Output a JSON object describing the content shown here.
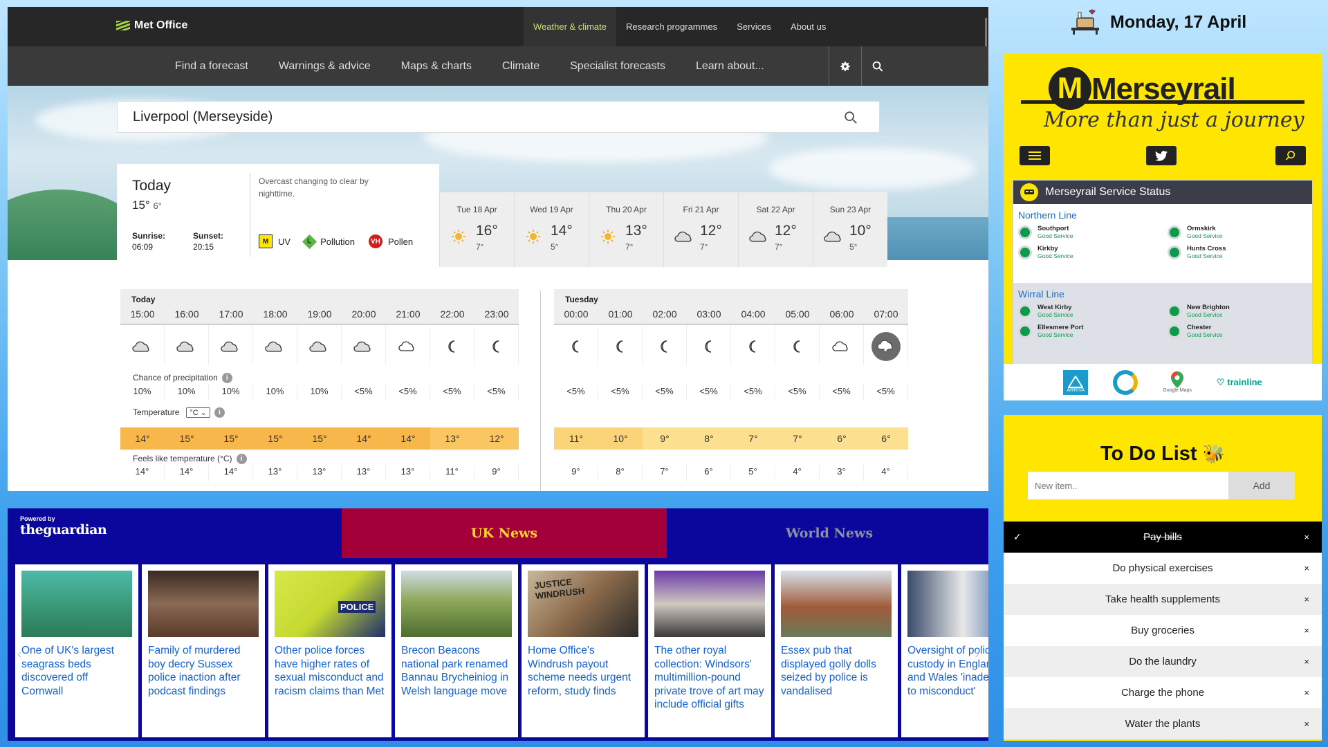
{
  "met": {
    "logo": "Met Office",
    "topnav": [
      "Weather & climate",
      "Research programmes",
      "Services",
      "About us"
    ],
    "nav": [
      "Find a forecast",
      "Warnings & advice",
      "Maps & charts",
      "Climate",
      "Specialist forecasts",
      "Learn about..."
    ],
    "search_value": "Liverpool (Merseyside)",
    "today": {
      "label": "Today",
      "high": "15°",
      "low": "6°",
      "sunrise_label": "Sunrise:",
      "sunrise": "06:09",
      "sunset_label": "Sunset:",
      "sunset": "20:15",
      "description": "Overcast changing to clear by nighttime.",
      "uv_badge": "M",
      "uv_label": "UV",
      "pollution_badge": "L",
      "pollution_label": "Pollution",
      "pollen_badge": "VH",
      "pollen_label": "Pollen"
    },
    "days": [
      {
        "label": "Tue 18 Apr",
        "high": "16°",
        "low": "7°",
        "icon": "sun-icon"
      },
      {
        "label": "Wed 19 Apr",
        "high": "14°",
        "low": "5°",
        "icon": "sun-icon"
      },
      {
        "label": "Thu 20 Apr",
        "high": "13°",
        "low": "7°",
        "icon": "sun-icon"
      },
      {
        "label": "Fri 21 Apr",
        "high": "12°",
        "low": "7°",
        "icon": "cloud-icon"
      },
      {
        "label": "Sat 22 Apr",
        "high": "12°",
        "low": "7°",
        "icon": "cloud-icon"
      },
      {
        "label": "Sun 23 Apr",
        "high": "10°",
        "low": "5°",
        "icon": "cloud-icon"
      }
    ],
    "hourly_today": {
      "label": "Today",
      "times": [
        "15:00",
        "16:00",
        "17:00",
        "18:00",
        "19:00",
        "20:00",
        "21:00",
        "22:00",
        "23:00"
      ],
      "icons": [
        "cloud",
        "cloud",
        "cloud",
        "cloud",
        "cloud",
        "cloud",
        "partly-cloudy-night",
        "moon",
        "moon"
      ],
      "precip": [
        "10%",
        "10%",
        "10%",
        "10%",
        "10%",
        "<5%",
        "<5%",
        "<5%",
        "<5%"
      ],
      "temps": [
        "14°",
        "15°",
        "15°",
        "15°",
        "15°",
        "14°",
        "14°",
        "13°",
        "12°"
      ],
      "feels": [
        "14°",
        "14°",
        "14°",
        "13°",
        "13°",
        "13°",
        "13°",
        "11°",
        "9°"
      ]
    },
    "hourly_tue": {
      "label": "Tuesday",
      "times": [
        "00:00",
        "01:00",
        "02:00",
        "03:00",
        "04:00",
        "05:00",
        "06:00",
        "07:00"
      ],
      "icons": [
        "moon",
        "moon",
        "moon",
        "moon",
        "moon",
        "moon",
        "partly-cloudy-night",
        "next"
      ],
      "precip": [
        "<5%",
        "<5%",
        "<5%",
        "<5%",
        "<5%",
        "<5%",
        "<5%",
        "<5%"
      ],
      "temps": [
        "11°",
        "10°",
        "9°",
        "8°",
        "7°",
        "7°",
        "6°",
        "6°"
      ],
      "feels": [
        "9°",
        "8°",
        "7°",
        "6°",
        "5°",
        "4°",
        "3°",
        "4°"
      ]
    },
    "precip_label": "Chance of precipitation",
    "temp_label": "Temperature",
    "unit": "°C",
    "feels_label": "Feels like temperature (°C)"
  },
  "guardian": {
    "powered_by": "Powered by",
    "brand": "theguardian",
    "tabs": [
      "UK News",
      "World News"
    ],
    "articles": [
      "One of UK's largest seagrass beds discovered off Cornwall",
      "Family of murdered boy decry Sussex police inaction after podcast findings",
      "Other police forces have higher rates of sexual misconduct and racism claims than Met",
      "Brecon Beacons national park renamed Bannau Brycheiniog in Welsh language move",
      "Home Office's Windrush payout scheme needs urgent reform, study finds",
      "The other royal collection: Windsors' multimillion-pound private trove of art may include official gifts",
      "Essex pub that displayed golly dolls seized by police is vandalised",
      "Oversight of police custody in England and Wales 'inadequate to misconduct'"
    ],
    "img_texts": [
      "POLICE",
      "JUSTICE WINDRUSH"
    ]
  },
  "date": "Monday, 17 April",
  "merseyrail": {
    "logo": "Merseyrail",
    "tagline": "More than just a journey",
    "status_title": "Merseyrail Service Status",
    "lines": [
      {
        "name": "Northern Line",
        "stations": [
          {
            "name": "Southport",
            "status": "Good Service"
          },
          {
            "name": "Ormskirk",
            "status": "Good Service"
          },
          {
            "name": "Kirkby",
            "status": "Good Service"
          },
          {
            "name": "Hunts Cross",
            "status": "Good Service"
          }
        ]
      },
      {
        "name": "Wirral Line",
        "stations": [
          {
            "name": "West Kirby",
            "status": "Good Service"
          },
          {
            "name": "New Brighton",
            "status": "Good Service"
          },
          {
            "name": "Ellesmere Port",
            "status": "Good Service"
          },
          {
            "name": "Chester",
            "status": "Good Service"
          }
        ]
      }
    ],
    "partners": [
      "ARRIVA",
      "Google Maps",
      "trainline"
    ]
  },
  "todo": {
    "title": "To Do List",
    "placeholder": "New item..",
    "add_label": "Add",
    "items": [
      {
        "text": "Pay bills",
        "done": true
      },
      {
        "text": "Do physical exercises",
        "done": false
      },
      {
        "text": "Take health supplements",
        "done": false
      },
      {
        "text": "Buy groceries",
        "done": false
      },
      {
        "text": "Do the laundry",
        "done": false
      },
      {
        "text": "Charge the phone",
        "done": false
      },
      {
        "text": "Water the plants",
        "done": false
      }
    ]
  },
  "colors": {
    "met_dark": "#272727",
    "met_orange": "#f7b74a",
    "guardian_blue": "#0b079c",
    "guardian_red": "#a3003a",
    "merseyrail_yellow": "#ffe600",
    "good_service": "#0b9b4c"
  }
}
